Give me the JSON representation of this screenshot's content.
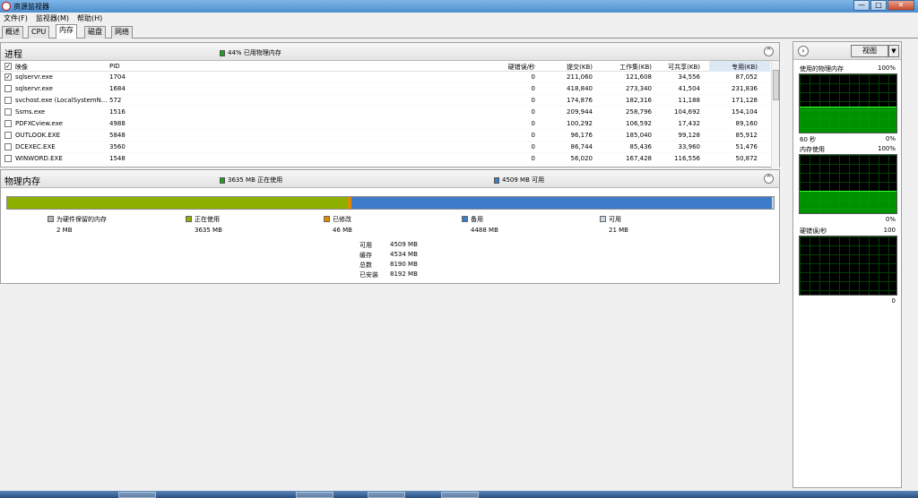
{
  "window": {
    "title": "资源监视器",
    "title_suffix": "",
    "controls": [
      "—",
      "□",
      "✕"
    ]
  },
  "menu": [
    "文件(F)",
    "监视器(M)",
    "帮助(H)"
  ],
  "tabs": [
    {
      "label": "概述",
      "active": false
    },
    {
      "label": "CPU",
      "active": false
    },
    {
      "label": "内存",
      "active": true
    },
    {
      "label": "磁盘",
      "active": false
    },
    {
      "label": "网络",
      "active": false
    }
  ],
  "processes": {
    "title": "进程",
    "status": "44% 已用物理内存",
    "status_color": "#1aa31a",
    "columns": [
      "映像",
      "PID",
      "硬错误/秒",
      "提交(KB)",
      "工作集(KB)",
      "可共享(KB)",
      "专用(KB)"
    ],
    "rows": [
      {
        "checked": true,
        "name": "sqlservr.exe",
        "pid": "1704",
        "hard": "0",
        "commit": "211,060",
        "ws": "121,608",
        "share": "34,556",
        "priv": "87,052"
      },
      {
        "checked": false,
        "name": "sqlservr.exe",
        "pid": "1684",
        "hard": "0",
        "commit": "418,840",
        "ws": "273,340",
        "share": "41,504",
        "priv": "231,836"
      },
      {
        "checked": false,
        "name": "svchost.exe (LocalSystemN...",
        "pid": "572",
        "hard": "0",
        "commit": "174,876",
        "ws": "182,316",
        "share": "11,188",
        "priv": "171,128"
      },
      {
        "checked": false,
        "name": "Ssms.exe",
        "pid": "1516",
        "hard": "0",
        "commit": "209,944",
        "ws": "258,796",
        "share": "104,692",
        "priv": "154,104"
      },
      {
        "checked": false,
        "name": "PDFXCview.exe",
        "pid": "4988",
        "hard": "0",
        "commit": "100,292",
        "ws": "106,592",
        "share": "17,432",
        "priv": "89,160"
      },
      {
        "checked": false,
        "name": "OUTLOOK.EXE",
        "pid": "5848",
        "hard": "0",
        "commit": "96,176",
        "ws": "185,040",
        "share": "99,128",
        "priv": "85,912"
      },
      {
        "checked": false,
        "name": "DCEXEC.EXE",
        "pid": "3560",
        "hard": "0",
        "commit": "86,744",
        "ws": "85,436",
        "share": "33,960",
        "priv": "51,476"
      },
      {
        "checked": false,
        "name": "WINWORD.EXE",
        "pid": "1548",
        "hard": "0",
        "commit": "56,020",
        "ws": "167,428",
        "share": "116,556",
        "priv": "50,872"
      }
    ]
  },
  "physical": {
    "title": "物理内存",
    "status_inuse": "3635 MB 正在使用",
    "status_avail": "4509 MB 可用",
    "bar": {
      "reserved_mb": 2,
      "inuse_mb": 3635,
      "modified_mb": 46,
      "standby_mb": 4488,
      "free_mb": 21
    },
    "legend": [
      {
        "label": "为硬件保留的内存",
        "value": "2 MB",
        "color": "#b4b4b4"
      },
      {
        "label": "正在使用",
        "value": "3635 MB",
        "color": "#8db000"
      },
      {
        "label": "已修改",
        "value": "46 MB",
        "color": "#e08a00"
      },
      {
        "label": "备用",
        "value": "4488 MB",
        "color": "#3e7cc9"
      },
      {
        "label": "可用",
        "value": "21 MB",
        "color": "#c8d8e8"
      }
    ],
    "summary": [
      {
        "label": "可用",
        "value": "4509 MB"
      },
      {
        "label": "缓存",
        "value": "4534 MB"
      },
      {
        "label": "总数",
        "value": "8190 MB"
      },
      {
        "label": "已安装",
        "value": "8192 MB"
      }
    ]
  },
  "right_pane": {
    "view_label": "视图",
    "graphs": [
      {
        "title": "使用的物理内存",
        "max": "100%",
        "min_left": "60 秒",
        "min_right": "0%",
        "level_percent": 44
      },
      {
        "title": "内存使用",
        "max": "100%",
        "min_left": "",
        "min_right": "0%",
        "level_percent": 38
      },
      {
        "title": "硬错误/秒",
        "max": "100",
        "min_left": "",
        "min_right": "0",
        "level_percent": 0
      }
    ]
  }
}
